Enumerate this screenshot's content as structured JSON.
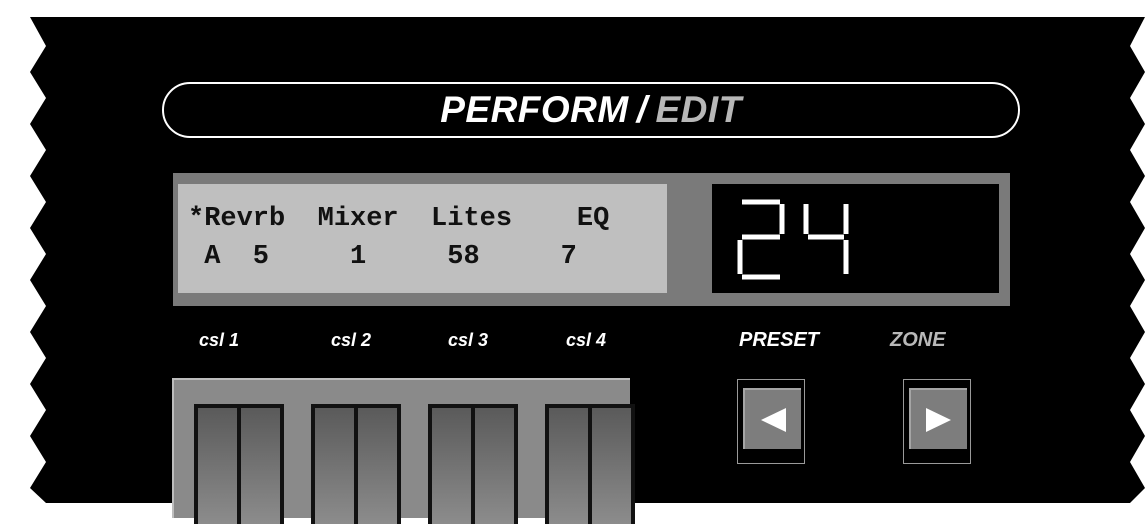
{
  "title": {
    "part1": "PERFORM",
    "separator": "/",
    "part2": "EDIT"
  },
  "lcd": {
    "row1": "*Revrb  Mixer  Lites    EQ",
    "row2": " A  5     1     58     7"
  },
  "led_display": {
    "value": "24"
  },
  "sliders": [
    {
      "label": "csl 1"
    },
    {
      "label": "csl 2"
    },
    {
      "label": "csl 3"
    },
    {
      "label": "csl 4"
    }
  ],
  "buttons": {
    "preset_label": "PRESET",
    "zone_label": "ZONE",
    "preset_icon": "left-arrow-icon",
    "zone_icon": "right-arrow-icon"
  },
  "colors": {
    "panel": "#000000",
    "lcd_bg": "#bfbfbf",
    "frame": "#7a7a7a",
    "edit_text": "#b8b8b8",
    "led_segment": "#ffffff"
  }
}
